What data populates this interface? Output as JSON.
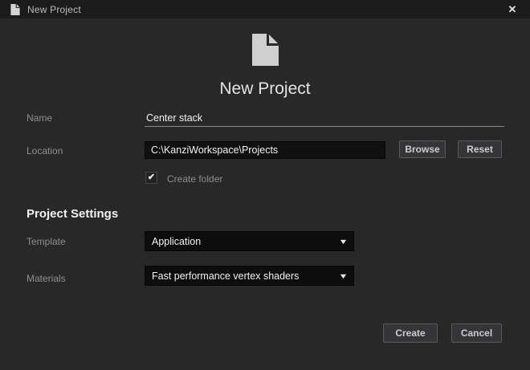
{
  "titlebar": {
    "title": "New Project"
  },
  "icons": {
    "close": "✕",
    "check": "✔",
    "chevron_down": "▼",
    "document_icon_color": "#cfcfcf"
  },
  "hero": {
    "title": "New Project"
  },
  "form": {
    "name": {
      "label": "Name",
      "value": "Center stack"
    },
    "location": {
      "label": "Location",
      "value": "C:\\KanziWorkspace\\Projects",
      "browse_label": "Browse",
      "reset_label": "Reset"
    },
    "create_folder": {
      "label": "Create folder",
      "checked": true
    },
    "section_title": "Project Settings",
    "template": {
      "label": "Template",
      "value": "Application"
    },
    "materials": {
      "label": "Materials",
      "value": "Fast performance vertex shaders"
    }
  },
  "footer": {
    "create_label": "Create",
    "cancel_label": "Cancel"
  },
  "colors": {
    "titlebar_bg": "#1b1b1c",
    "body_bg": "#282828",
    "field_bg": "#101010",
    "button_bg": "#353538",
    "button_border": "#59595c",
    "label_text": "#8f8f8f",
    "value_text": "#f2f2f2"
  }
}
